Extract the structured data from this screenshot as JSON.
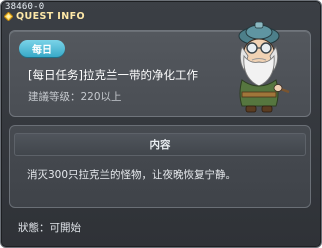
{
  "window": {
    "quest_id": "38460-0",
    "title": "QUEST INFO"
  },
  "quest": {
    "category_badge": "每日",
    "title": "[每日任务]拉克兰一带的净化工作",
    "level_requirement": "建議等级：220以上"
  },
  "content": {
    "header": "内容",
    "description": "消灭300只拉克兰的怪物，让夜晚恢复宁静。"
  },
  "status": {
    "text": "狀態：可開始"
  },
  "colors": {
    "badge": "#38a9c8",
    "title_accent": "#ffe9a8",
    "panel_bg": "#3b3f45"
  },
  "icons": {
    "title_icon": "quest-diamond-icon",
    "npc": "old-sage-npc"
  }
}
